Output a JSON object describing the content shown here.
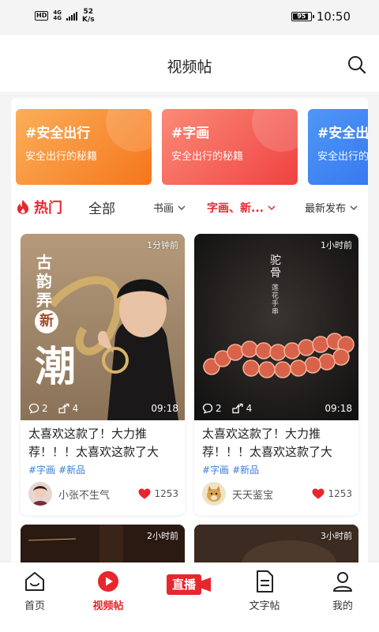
{
  "status_bar": {
    "hd": "HD",
    "net_type_top": "4G",
    "net_type_bottom": "4G",
    "speed_value": "52",
    "speed_unit": "K/s",
    "battery": "95",
    "time": "10:50"
  },
  "header": {
    "title": "视频帖",
    "search_icon": "search-icon"
  },
  "topics": [
    {
      "title": "#安全出行",
      "subtitle": "安全出行的秘籍",
      "color_from": "#fbae5a",
      "color_to": "#f5761b"
    },
    {
      "title": "#字画",
      "subtitle": "安全出行的秘籍",
      "color_from": "#fb8a77",
      "color_to": "#ef4241"
    },
    {
      "title": "#安全出行",
      "subtitle": "安全出行的秘籍",
      "color_from": "#4f97f5",
      "color_to": "#2a69ef"
    }
  ],
  "filters": {
    "hot_label": "热门",
    "all_label": "全部",
    "dropdowns": [
      {
        "label": "书画",
        "active": false
      },
      {
        "label": "字画、新...",
        "active": true
      },
      {
        "label": "最新发布",
        "active": false
      }
    ]
  },
  "posts": [
    {
      "time_ago": "1分钟前",
      "comments": "2",
      "shares": "4",
      "duration": "09:18",
      "title": "太喜欢这款了！大力推荐！！！太喜欢这款了大力...",
      "tags": [
        "#字画",
        "#新品"
      ],
      "author": "小张不生气",
      "likes": "1253",
      "poster_text": {
        "line1": "古韵弄",
        "circle": "新",
        "big": "潮"
      }
    },
    {
      "time_ago": "1小时前",
      "comments": "2",
      "shares": "4",
      "duration": "09:18",
      "title": "太喜欢这款了！大力推荐！！！太喜欢这款了大力...",
      "tags": [
        "#字画",
        "#新品"
      ],
      "author": "天天鉴宝",
      "likes": "1253",
      "poster_text": {
        "line1": "驼骨",
        "line2": "莲花手串"
      }
    }
  ],
  "more_posts": [
    {
      "time_ago": "2小时前"
    },
    {
      "time_ago": "3小时前"
    }
  ],
  "tabbar": {
    "items": [
      {
        "label": "首页",
        "icon": "home-icon",
        "active": false
      },
      {
        "label": "视频帖",
        "icon": "video-play-icon",
        "active": true
      },
      {
        "label": "直播",
        "icon": "live-camera-icon",
        "active": false
      },
      {
        "label": "文字帖",
        "icon": "document-icon",
        "active": false
      },
      {
        "label": "我的",
        "icon": "user-icon",
        "active": false
      }
    ]
  },
  "colors": {
    "accent": "#e8262d",
    "tag": "#3c7bd6"
  }
}
